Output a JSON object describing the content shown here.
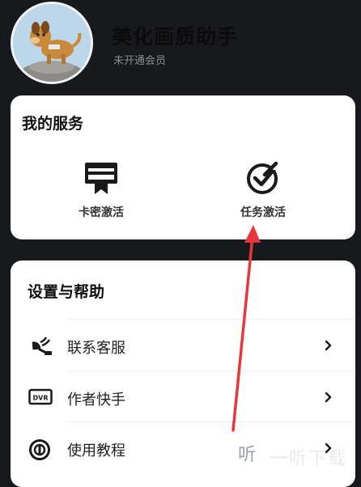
{
  "header": {
    "app_title": "美化画质助手",
    "member_status": "未开通会员"
  },
  "services": {
    "title": "我的服务",
    "items": [
      {
        "label": "卡密激活",
        "icon": "card-key-icon"
      },
      {
        "label": "任务激活",
        "icon": "check-circle-icon"
      }
    ]
  },
  "help": {
    "title": "设置与帮助",
    "items": [
      {
        "label": "联系客服",
        "icon": "satellite-dish-icon"
      },
      {
        "label": "作者快手",
        "icon": "dvr-icon"
      },
      {
        "label": "使用教程",
        "icon": "play-circle-icon"
      }
    ]
  },
  "annotation": {
    "color": "#e8373c"
  },
  "watermark": {
    "logo_char": "听",
    "text": "一听下载"
  }
}
